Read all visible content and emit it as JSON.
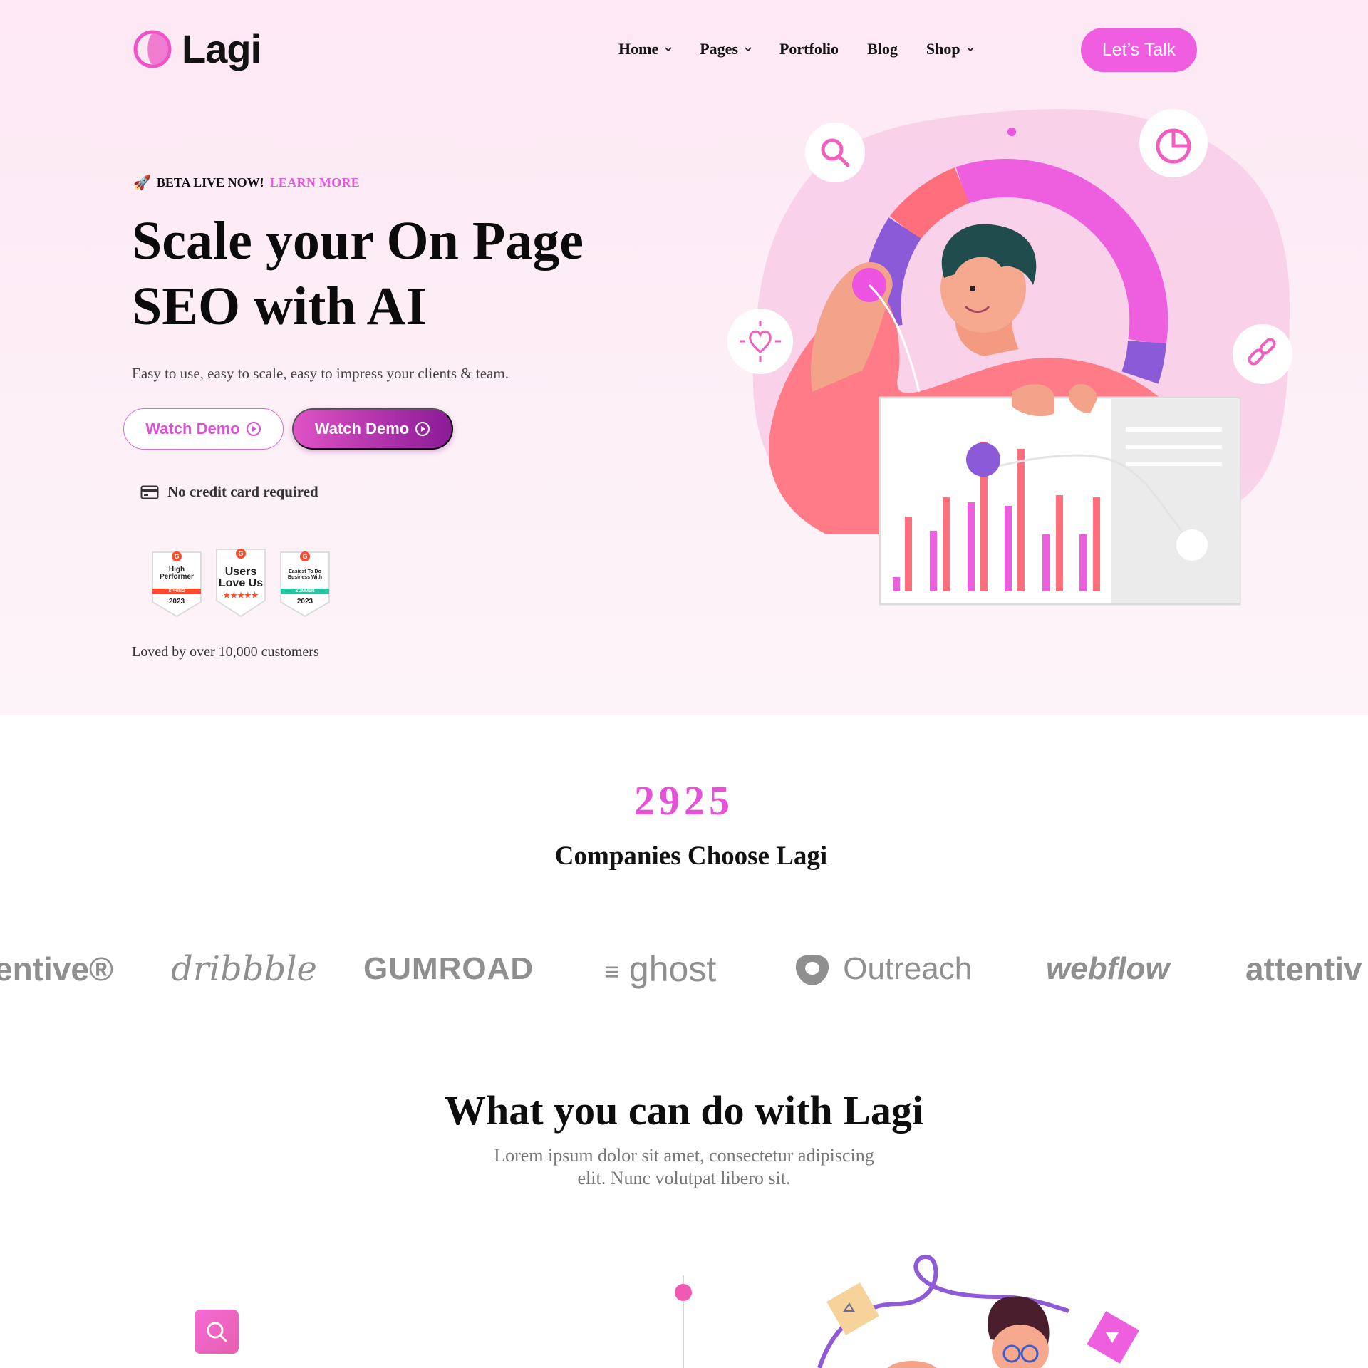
{
  "header": {
    "logo_text": "Lagi",
    "nav": [
      {
        "label": "Home",
        "has_dropdown": true
      },
      {
        "label": "Pages",
        "has_dropdown": true
      },
      {
        "label": "Portfolio",
        "has_dropdown": false
      },
      {
        "label": "Blog",
        "has_dropdown": false
      },
      {
        "label": "Shop",
        "has_dropdown": true
      }
    ],
    "cta_label": "Let’s Talk"
  },
  "hero": {
    "beta_icon": "rocket-icon",
    "beta_text": "BETA LIVE NOW!",
    "beta_link": "LEARN MORE",
    "title_line1": "Scale your On Page",
    "title_line2": "SEO with AI",
    "subtitle": "Easy to use, easy to scale, easy to impress your clients & team.",
    "btn_outline_label": "Watch Demo",
    "btn_solid_label": "Watch Demo",
    "no_cc_text": "No credit card required",
    "badges": [
      {
        "line1": "High",
        "line2": "Performer",
        "ribbon": "SPRING",
        "year": "2023",
        "ribbon_color": "#ff492c"
      },
      {
        "line1": "Users",
        "line2": "Love Us",
        "ribbon": "★★★★★",
        "year": "",
        "ribbon_color": "#ffffff"
      },
      {
        "line1": "Easiest To Do",
        "line2": "Business With",
        "ribbon": "SUMMER",
        "year": "2023",
        "ribbon_color": "#26c6a2"
      }
    ],
    "loved_text": "Loved by over 10,000 customers"
  },
  "stats": {
    "count": "2925",
    "label": "Companies Choose Lagi"
  },
  "brands": [
    "entive®",
    "dribbble",
    "GUMROAD",
    "ghost",
    "Outreach",
    "webflow",
    "attentiv"
  ],
  "features": {
    "title": "What you can do with Lagi",
    "subtitle_line1": "Lorem ipsum dolor sit amet, consectetur adipiscing",
    "subtitle_line2": "elit. Nunc volutpat libero sit."
  },
  "colors": {
    "accent": "#ef5ee0",
    "accent_dark": "#8a1b96",
    "hero_bg": "#fde8f3",
    "counter": "#e651d8"
  }
}
